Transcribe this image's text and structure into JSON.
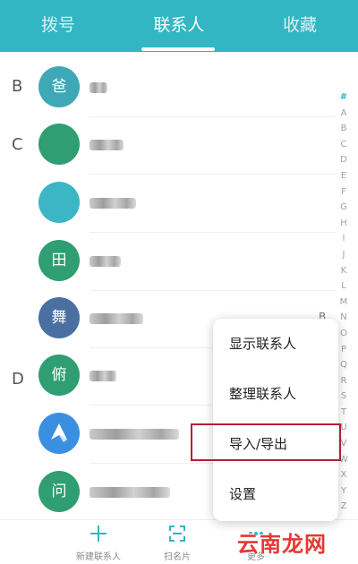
{
  "tabs": [
    {
      "label": "拨号",
      "active": false
    },
    {
      "label": "联系人",
      "active": true
    },
    {
      "label": "收藏",
      "active": false
    }
  ],
  "colors": {
    "accent": "#32b6c4",
    "highlight_border": "#b4212f",
    "watermark": "#e53935"
  },
  "sections": [
    {
      "letter": "B"
    },
    {
      "letter": "C"
    },
    {
      "letter": "D"
    }
  ],
  "contacts": [
    {
      "avatar_char": "爸",
      "avatar_color": "#3fa8b6"
    },
    {
      "avatar_char": "",
      "avatar_color": "#2f9e72"
    },
    {
      "avatar_char": "",
      "avatar_color": "#3cb5c4"
    },
    {
      "avatar_char": "田",
      "avatar_color": "#2f9e72"
    },
    {
      "avatar_char": "舞",
      "avatar_color": "#4a6fa0"
    },
    {
      "avatar_char": "俯",
      "avatar_color": "#2f9e72"
    },
    {
      "avatar_char": "",
      "avatar_color": "#3b8fe0",
      "icon": "bird-logo-icon"
    },
    {
      "avatar_char": "问",
      "avatar_color": "#2f9e72"
    }
  ],
  "alphabet_index": [
    "#",
    "A",
    "B",
    "C",
    "D",
    "E",
    "F",
    "G",
    "H",
    "I",
    "J",
    "K",
    "L",
    "M",
    "N",
    "O",
    "P",
    "Q",
    "R",
    "S",
    "T",
    "U",
    "V",
    "W",
    "X",
    "Y",
    "Z"
  ],
  "side_letter": "B",
  "menu": {
    "items": [
      {
        "label": "显示联系人"
      },
      {
        "label": "整理联系人"
      },
      {
        "label": "导入/导出",
        "highlighted": true
      },
      {
        "label": "设置"
      }
    ]
  },
  "bottom_bar": {
    "items": [
      {
        "label": "新建联系人",
        "icon": "plus-icon"
      },
      {
        "label": "扫名片",
        "icon": "scan-icon"
      },
      {
        "label": "更多",
        "icon": "more-icon"
      }
    ]
  },
  "watermark": "云南龙网"
}
